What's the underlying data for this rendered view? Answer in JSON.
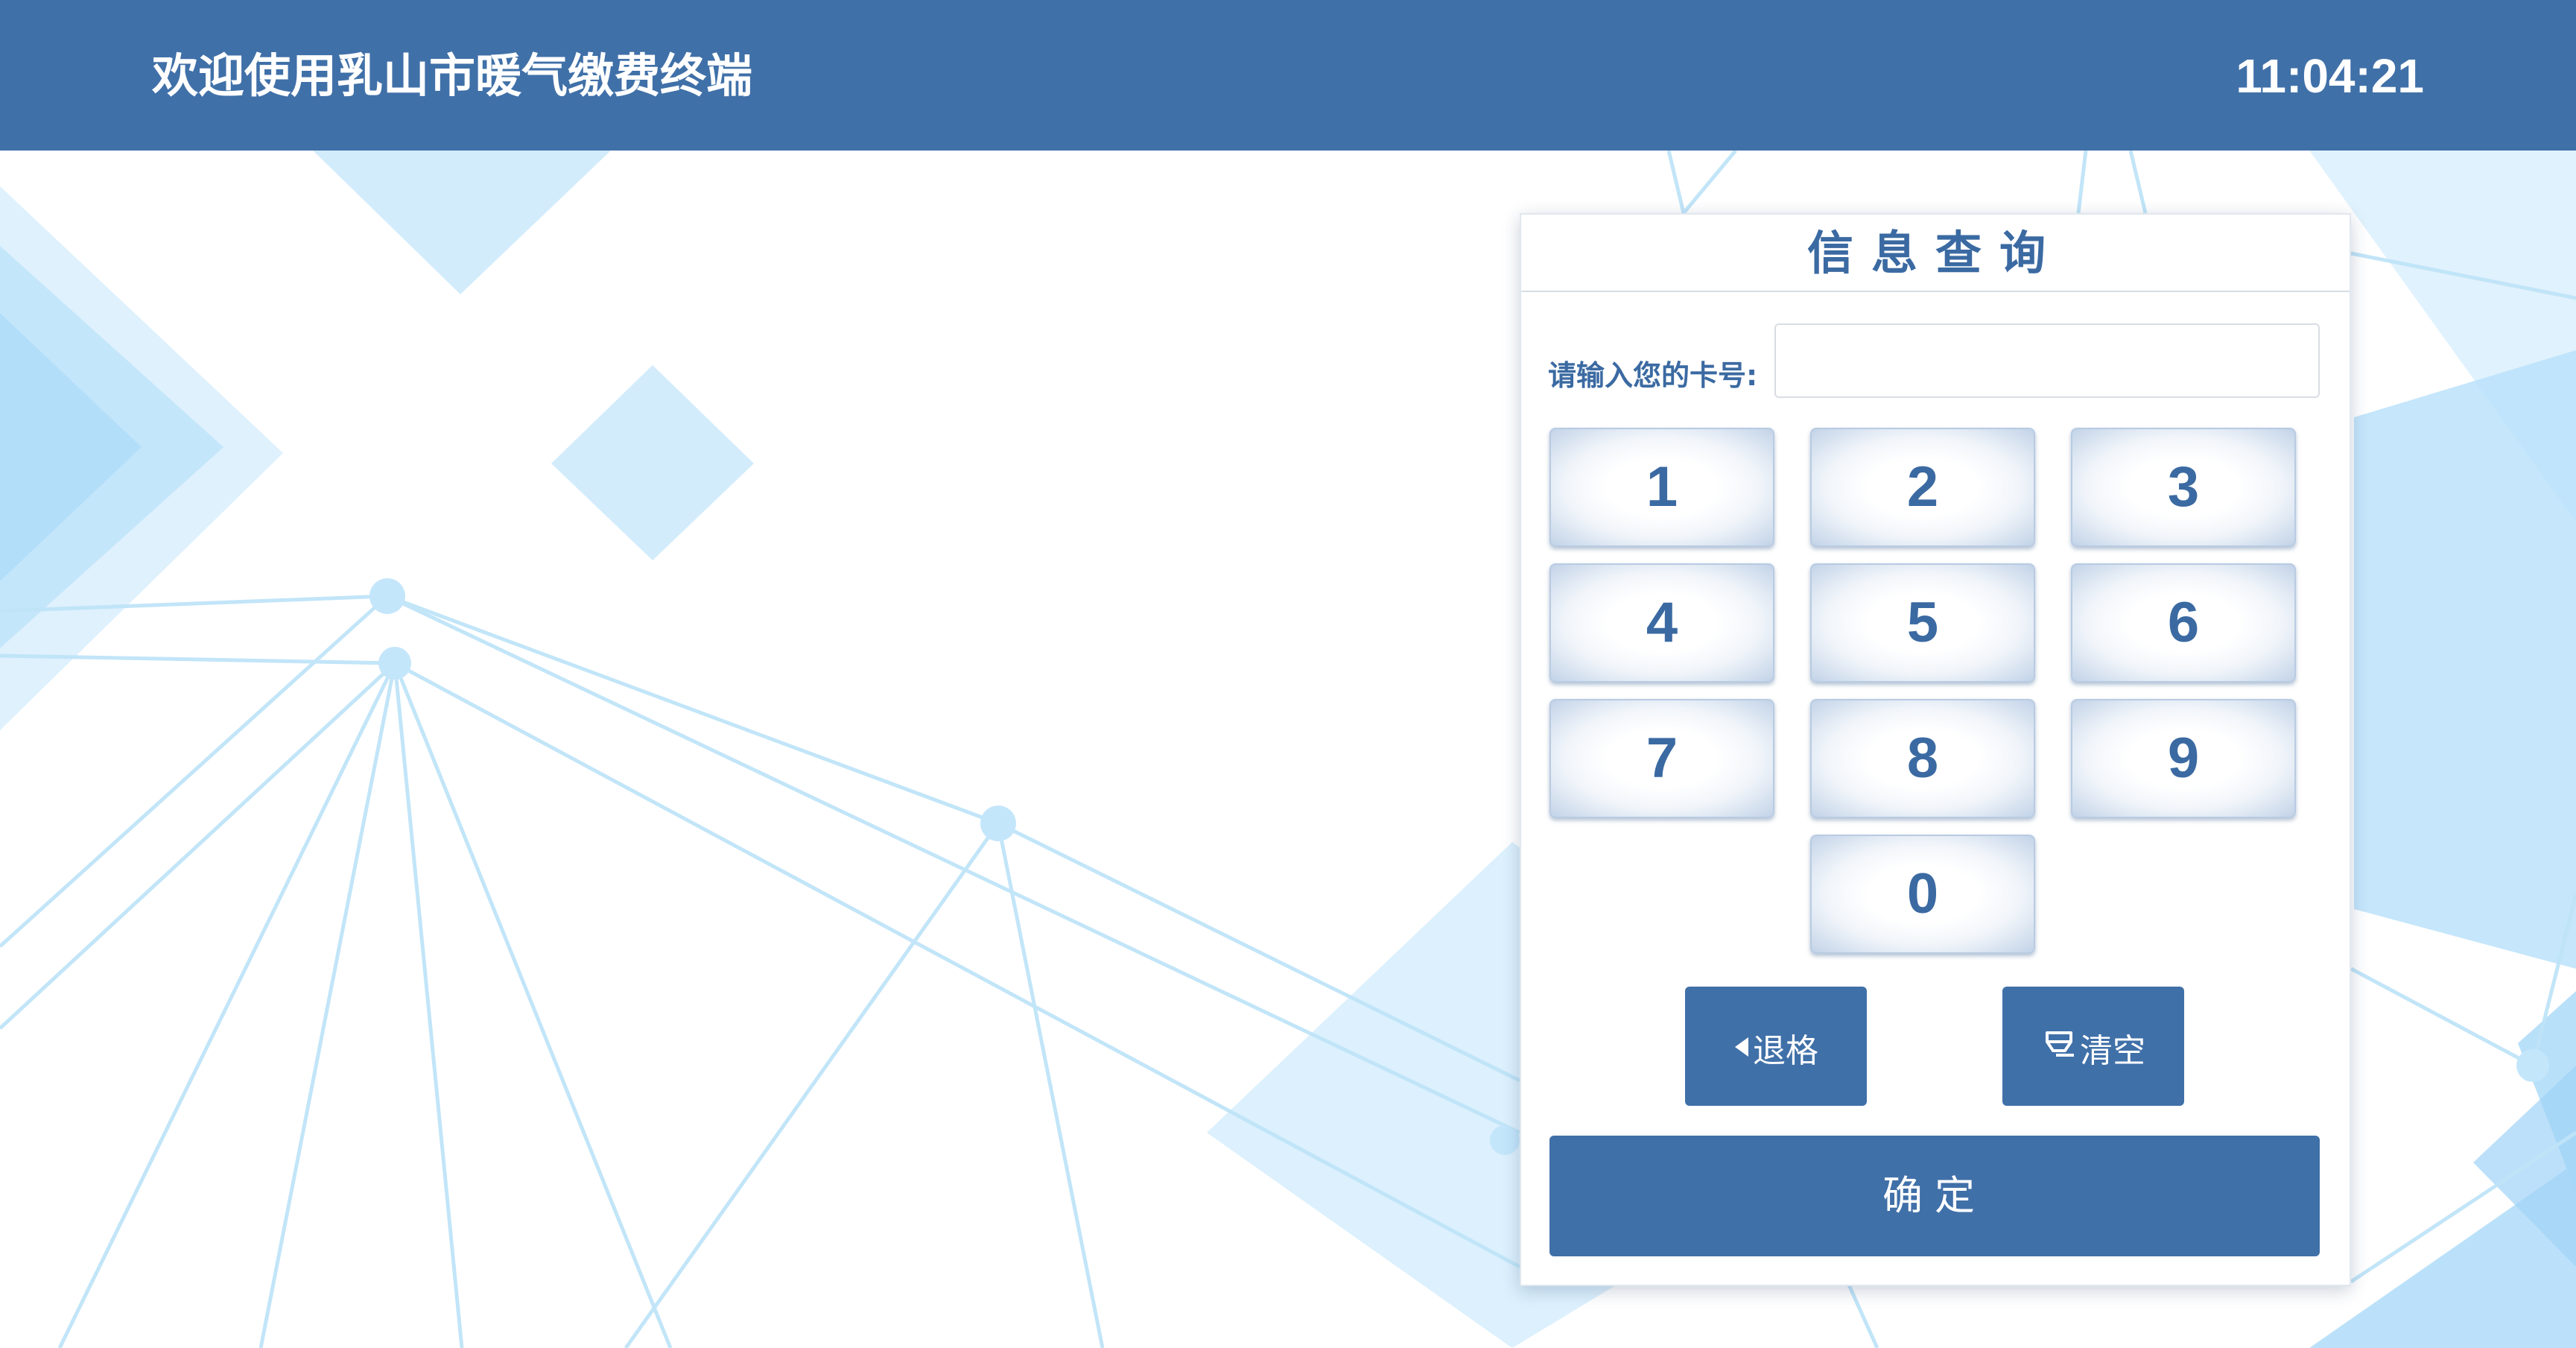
{
  "header": {
    "title": "欢迎使用乳山市暖气缴费终端",
    "clock": "11:04:21"
  },
  "query_panel": {
    "title": "信息查询",
    "card_label": "请输入您的卡号:",
    "card_value": "",
    "keypad": [
      "1",
      "2",
      "3",
      "4",
      "5",
      "6",
      "7",
      "8",
      "9",
      "0"
    ],
    "backspace_label": "退格",
    "backspace_icon": "caret-left-icon",
    "clear_label": "清空",
    "clear_icon": "eraser-icon",
    "confirm_label": "确定"
  },
  "colors": {
    "brand": "#4070a8",
    "accent_text": "#3b6aa2",
    "background_shapes": "#cde9fb"
  }
}
